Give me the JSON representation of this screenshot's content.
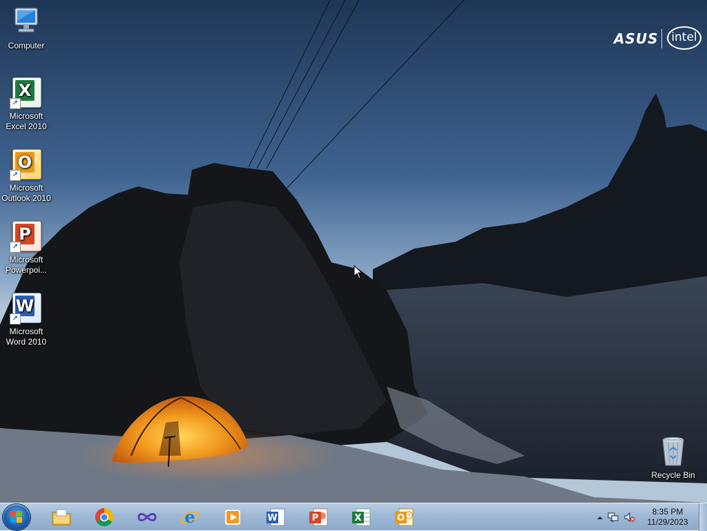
{
  "desktop": {
    "icons": [
      {
        "label": "Computer",
        "icon": "computer-icon"
      },
      {
        "label": "Microsoft Excel 2010",
        "icon": "excel-icon"
      },
      {
        "label": "Microsoft Outlook 2010",
        "icon": "outlook-icon"
      },
      {
        "label": "Microsoft Powerpoi...",
        "icon": "powerpoint-icon"
      },
      {
        "label": "Microsoft Word 2010",
        "icon": "word-icon"
      }
    ],
    "recycle_bin": {
      "label": "Recycle Bin",
      "icon": "recycle-bin-icon"
    },
    "logos": {
      "asus": "ASUS",
      "intel": "intel"
    }
  },
  "taskbar": {
    "start": {
      "icon": "windows-start-icon"
    },
    "pinned": [
      {
        "icon": "file-explorer-icon"
      },
      {
        "icon": "chrome-icon"
      },
      {
        "icon": "visual-studio-icon"
      },
      {
        "icon": "internet-explorer-icon"
      },
      {
        "icon": "media-player-icon"
      },
      {
        "icon": "word-icon"
      },
      {
        "icon": "powerpoint-icon"
      },
      {
        "icon": "excel-icon"
      },
      {
        "icon": "outlook-icon"
      }
    ],
    "tray": {
      "time": "8:35 PM",
      "date": "11/29/2023",
      "icons": [
        "show-hidden-icons-icon",
        "network-icon",
        "volume-muted-icon"
      ]
    }
  },
  "colors": {
    "excel": "#1f7a3e",
    "outlook": "#e89a1c",
    "powerpoint": "#d24726",
    "word": "#2b5fb4",
    "tent": "#f39b1f"
  }
}
